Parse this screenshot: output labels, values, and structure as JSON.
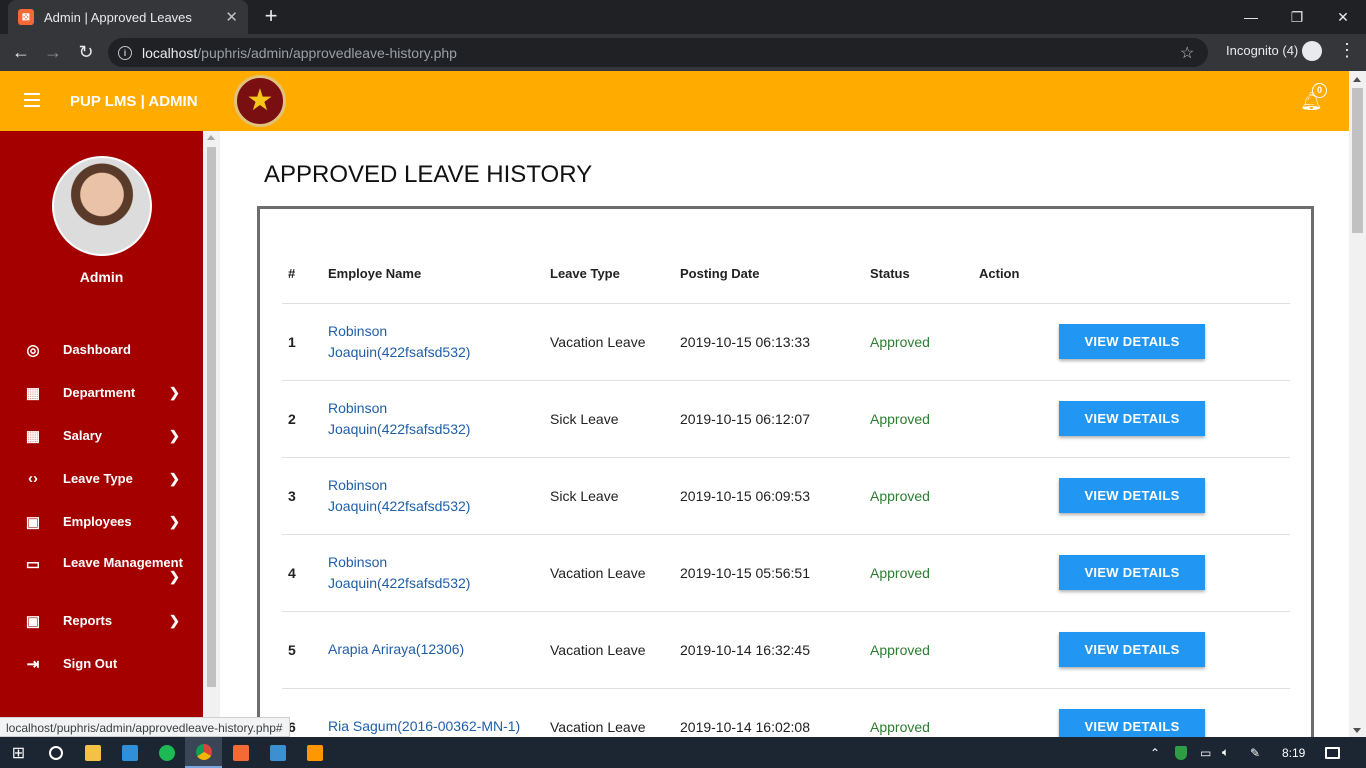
{
  "browser": {
    "tab_title": "Admin | Approved Leaves",
    "tab_favicon": "XAMPP",
    "url_host": "localhost",
    "url_path": "/puphris/admin/approvedleave-history.php",
    "incognito_label": "Incognito (4)",
    "status_url": "localhost/puphris/admin/approvedleave-history.php#"
  },
  "header": {
    "brand": "PUP LMS | ADMIN",
    "notification_count": "0",
    "bg_color": "#ffab00"
  },
  "sidebar": {
    "user_name": "Admin",
    "bg_color": "#a50000",
    "items": [
      {
        "label": "Dashboard",
        "icon": "dashboard-icon"
      },
      {
        "label": "Department",
        "icon": "grid-icon"
      },
      {
        "label": "Salary",
        "icon": "grid-icon"
      },
      {
        "label": "Leave Type",
        "icon": "code-icon"
      },
      {
        "label": "Employees",
        "icon": "person-card-icon"
      },
      {
        "label": "Leave Management",
        "icon": "monitor-icon"
      },
      {
        "label": "Reports",
        "icon": "person-card-icon"
      },
      {
        "label": "Sign Out",
        "icon": "sign-out-icon"
      }
    ]
  },
  "main": {
    "title": "APPROVED LEAVE HISTORY",
    "columns": [
      "#",
      "Employe Name",
      "Leave Type",
      "Posting Date",
      "Status",
      "Action"
    ],
    "button_label": "VIEW DETAILS",
    "rows": [
      {
        "num": "1",
        "name_line1": "Robinson",
        "name_line2": "Joaquin(422fsafsd532)",
        "type": "Vacation Leave",
        "date": "2019-10-15 06:13:33",
        "status": "Approved"
      },
      {
        "num": "2",
        "name_line1": "Robinson",
        "name_line2": "Joaquin(422fsafsd532)",
        "type": "Sick Leave",
        "date": "2019-10-15 06:12:07",
        "status": "Approved"
      },
      {
        "num": "3",
        "name_line1": "Robinson",
        "name_line2": "Joaquin(422fsafsd532)",
        "type": "Sick Leave",
        "date": "2019-10-15 06:09:53",
        "status": "Approved"
      },
      {
        "num": "4",
        "name_line1": "Robinson",
        "name_line2": "Joaquin(422fsafsd532)",
        "type": "Vacation Leave",
        "date": "2019-10-15 05:56:51",
        "status": "Approved"
      },
      {
        "num": "5",
        "name_line1": "Arapia Ariraya(12306)",
        "name_line2": "",
        "type": "Vacation Leave",
        "date": "2019-10-14 16:32:45",
        "status": "Approved"
      },
      {
        "num": "6",
        "name_line1": "Ria Sagum(2016-00362-MN-1)",
        "name_line2": "",
        "type": "Vacation Leave",
        "date": "2019-10-14 16:02:08",
        "status": "Approved"
      }
    ]
  },
  "taskbar": {
    "time": "8:19"
  }
}
